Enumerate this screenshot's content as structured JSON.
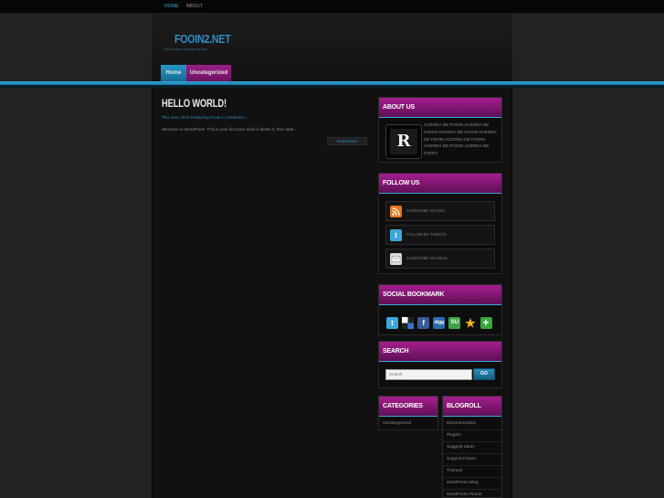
{
  "top_nav": {
    "items": [
      {
        "label": "HOME",
        "active": true
      },
      {
        "label": "ABOUT",
        "active": false
      }
    ]
  },
  "site": {
    "title": "FOOIN2.NET",
    "tagline": "yet another wordpress site"
  },
  "main_nav": {
    "tabs": [
      {
        "label": "Home"
      },
      {
        "label": "Uncategorized"
      }
    ]
  },
  "post": {
    "title": "HELLO WORLD!",
    "meta": "Thu, Nov, 2010  Posted by Fooin  1 Comment »",
    "excerpt": "Welcome to WordPress. This is your first post. Edit or delete it, then start…",
    "read_more": "Read More"
  },
  "about": {
    "heading": "ABOUT US",
    "logo_letter": "R",
    "text": "ACERDA DE FOOIN ACERDA DE FOOIN ACERDA DE FOOIN ACERDA DE FOOIN ACERDA DE FOOIN ACERDA DE FOOIN ACERDA DE FOOIN"
  },
  "follow": {
    "heading": "FOLLOW US",
    "items": [
      {
        "label": "SUBSCRIBE VIA RSS",
        "icon": "rss-icon"
      },
      {
        "label": "FOLLOW MY TWEETS",
        "icon": "twitter-icon"
      },
      {
        "label": "SUBSCRIBE VIA EMAIL",
        "icon": "email-icon"
      }
    ]
  },
  "social": {
    "heading": "SOCIAL BOOKMARK",
    "icons": [
      "twitter-icon",
      "delicious-icon",
      "facebook-icon",
      "digg-icon",
      "stumbleupon-icon",
      "favorites-star-icon",
      "add-bookmark-icon"
    ]
  },
  "search": {
    "heading": "SEARCH",
    "placeholder": "Search",
    "button": "GO"
  },
  "categories": {
    "heading": "CATEGORIES",
    "items": [
      "Uncategorized"
    ]
  },
  "blogroll": {
    "heading": "BLOGROLL",
    "items": [
      "Documentation",
      "Plugins",
      "Suggest Ideas",
      "Support Forum",
      "Themes",
      "WordPress Blog",
      "WordPress Planet"
    ]
  },
  "colors": {
    "accent_blue": "#2f8fc6",
    "accent_magenta": "#a61e8e",
    "background": "#232323"
  }
}
